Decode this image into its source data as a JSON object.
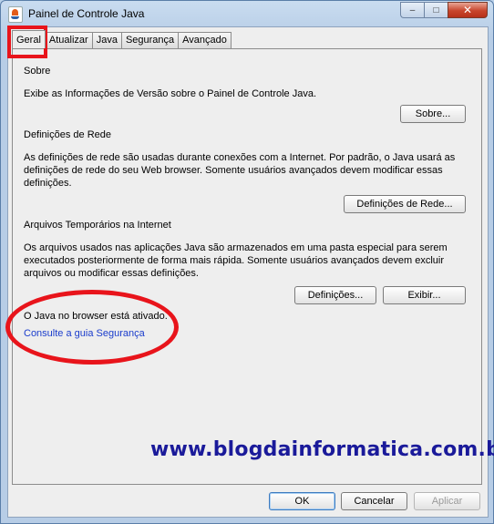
{
  "window": {
    "title": "Painel de Controle Java",
    "minimize_glyph": "–",
    "maximize_glyph": "□",
    "close_glyph": "✕"
  },
  "tabs": [
    {
      "label": "Geral"
    },
    {
      "label": "Atualizar"
    },
    {
      "label": "Java"
    },
    {
      "label": "Segurança"
    },
    {
      "label": "Avançado"
    }
  ],
  "sections": {
    "about": {
      "title": "Sobre",
      "description": "Exibe as Informações de Versão sobre o Painel de Controle Java.",
      "button": "Sobre..."
    },
    "network": {
      "title": "Definições de Rede",
      "line1": "As definições de rede são usadas durante conexões com a Internet. Por padrão, o Java usará as",
      "line2": "definições de rede do seu Web browser. Somente usuários avançados devem modificar essas",
      "line3": "definições.",
      "button": "Definições de Rede..."
    },
    "temp_files": {
      "title": "Arquivos Temporários na Internet",
      "line1": "Os arquivos usados nas aplicações Java são armazenados em uma pasta especial para serem",
      "line2": "executados posteriormente de forma mais rápida. Somente usuários avançados devem excluir",
      "line3": "arquivos ou modificar essas definições.",
      "settings_button": "Definições...",
      "view_button": "Exibir..."
    },
    "browser": {
      "status": "O Java no browser está ativado.",
      "link": "Consulte a guia Segurança"
    }
  },
  "watermark": "www.blogdainformatica.com.br",
  "footer": {
    "ok": "OK",
    "cancel": "Cancelar",
    "apply": "Aplicar"
  },
  "colors": {
    "highlight": "#e8141b",
    "link": "#1a3ccc",
    "watermark": "#1a1a9a"
  }
}
